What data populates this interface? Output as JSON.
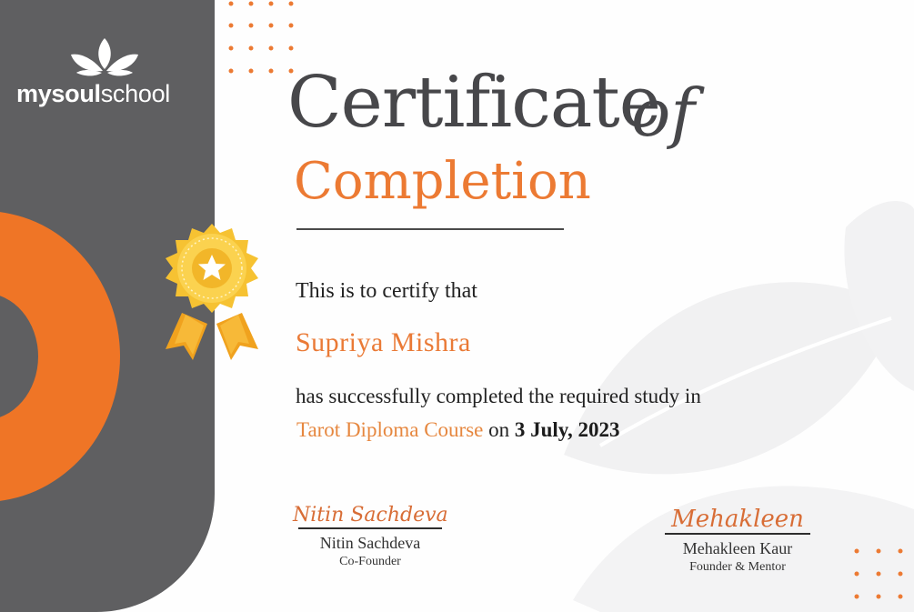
{
  "brand": {
    "logo_bold": "mysoul",
    "logo_light": "school",
    "icon": "lotus-icon"
  },
  "certificate": {
    "title_main": "Certificate",
    "title_of": "of",
    "title_sub": "Completion",
    "intro": "This is to certify that",
    "recipient": "Supriya Mishra",
    "statement": "has successfully completed the required study in",
    "course": "Tarot Diploma Course",
    "on_text": "on",
    "date": "3 July, 2023"
  },
  "signatories": [
    {
      "signature": "Nitin Sachdeva",
      "name": "Nitin Sachdeva",
      "role": "Co-Founder"
    },
    {
      "signature": "Mehakleen",
      "name": "Mehakleen Kaur",
      "role": "Founder & Mentor"
    }
  ],
  "decor": {
    "badge_icon": "star-ribbon-badge-icon",
    "colors": {
      "panel": "#5f5f61",
      "accent": "#ef7526",
      "gold": "#f6c232",
      "text": "#47474a"
    }
  }
}
